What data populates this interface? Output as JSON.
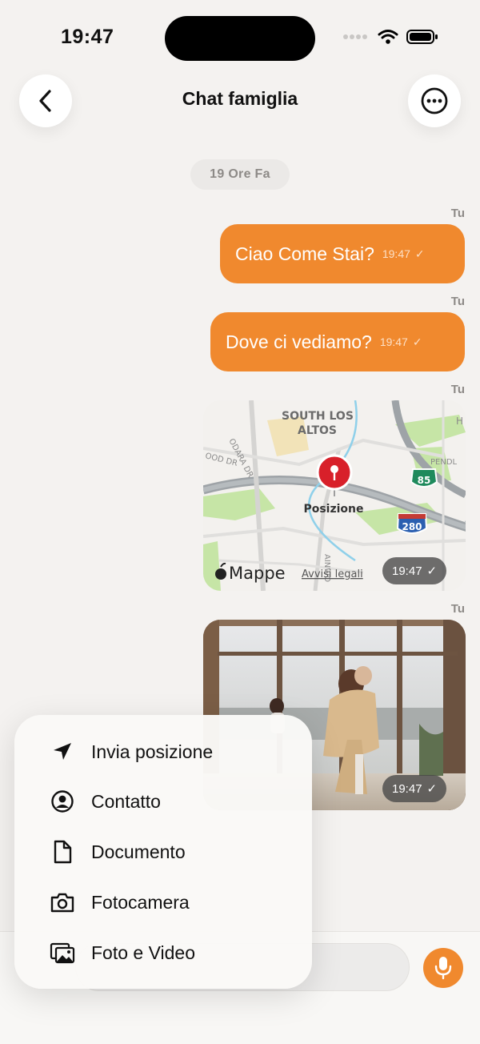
{
  "status_bar": {
    "time": "19:47"
  },
  "header": {
    "title": "Chat famiglia"
  },
  "conversation": {
    "date_separator": "19 Ore Fa",
    "messages": [
      {
        "sender": "Tu",
        "text": "Ciao Come Stai?",
        "time": "19:47",
        "status": "✓"
      },
      {
        "sender": "Tu",
        "text": "Dove ci vediamo?",
        "time": "19:47",
        "status": "✓"
      },
      {
        "sender": "Tu",
        "type": "location",
        "time": "19:47",
        "status": "✓",
        "map": {
          "place_label": "Posizione",
          "area_label_line1": "SOUTH LOS",
          "area_label_line2": "ALTOS",
          "road_label_1": "ODARA DR",
          "road_label_2": "OOD DR",
          "road_label_3": "PENDL",
          "road_label_4": "AINWO",
          "road_label_5": "H",
          "shield_85": "85",
          "shield_280": "280",
          "provider": "Mappe",
          "legal": "Avvisi legali"
        }
      },
      {
        "sender": "Tu",
        "type": "photo",
        "time": "19:47",
        "status": "✓"
      }
    ]
  },
  "attach_menu": {
    "items": [
      {
        "label": "Invia posizione",
        "icon": "location-arrow-icon"
      },
      {
        "label": "Contatto",
        "icon": "contact-icon"
      },
      {
        "label": "Documento",
        "icon": "document-icon"
      },
      {
        "label": "Fotocamera",
        "icon": "camera-icon"
      },
      {
        "label": "Foto e Video",
        "icon": "photos-icon"
      }
    ]
  },
  "colors": {
    "accent": "#f0892e",
    "background": "#f4f2f0",
    "muted_text": "#8d8a87"
  }
}
